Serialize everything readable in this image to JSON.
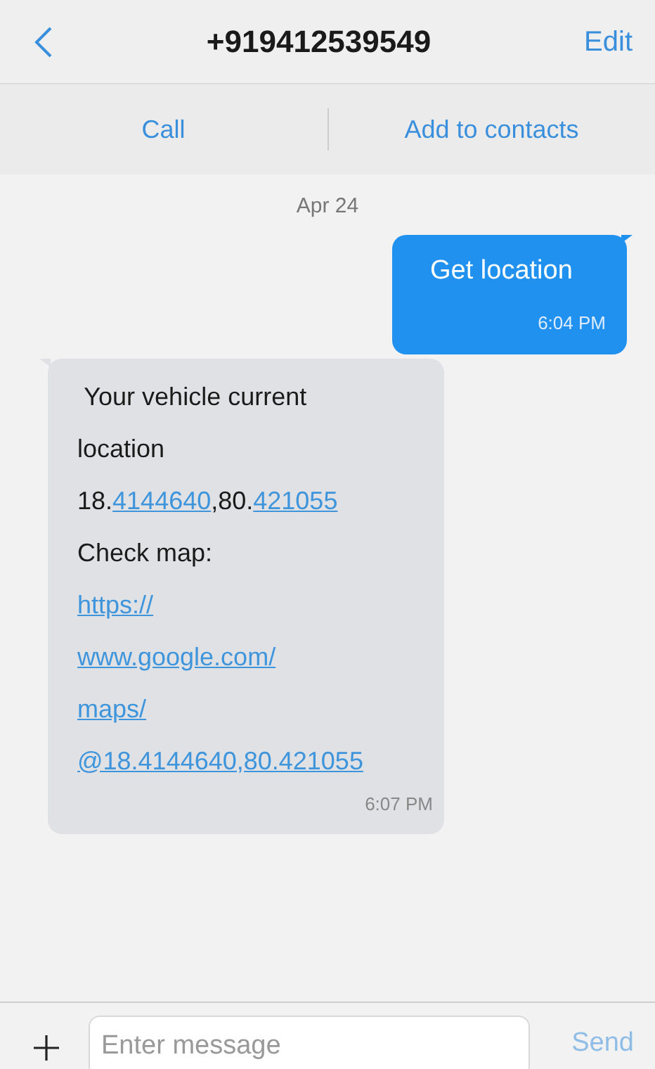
{
  "header": {
    "title": "+919412539549",
    "edit": "Edit"
  },
  "actions": [
    "Call",
    "Add to contacts"
  ],
  "date": "Apr 24",
  "messages": [
    {
      "kind": "sent",
      "lines": [
        [
          {
            "text": "Get location",
            "link": false
          }
        ]
      ],
      "time": "6:04 PM"
    },
    {
      "kind": "received",
      "lines": [
        [
          {
            "text": " Your vehicle current",
            "link": false
          }
        ],
        [
          {
            "text": "location",
            "link": false
          }
        ],
        [
          {
            "text": "18.",
            "link": false
          },
          {
            "text": "4144640",
            "link": true
          },
          {
            "text": ",80.",
            "link": false
          },
          {
            "text": "421055",
            "link": true
          }
        ],
        [
          {
            "text": "Check map:",
            "link": false
          }
        ],
        [
          {
            "text": "https://",
            "link": true
          }
        ],
        [
          {
            "text": "www.google.com/",
            "link": true
          }
        ],
        [
          {
            "text": "maps/",
            "link": true
          }
        ],
        [
          {
            "text": "@18.4144640,80.421055",
            "link": true
          }
        ]
      ],
      "time": "6:07 PM"
    }
  ],
  "composer": {
    "placeholder": "Enter message",
    "send": "Send",
    "send_disabled": true
  }
}
